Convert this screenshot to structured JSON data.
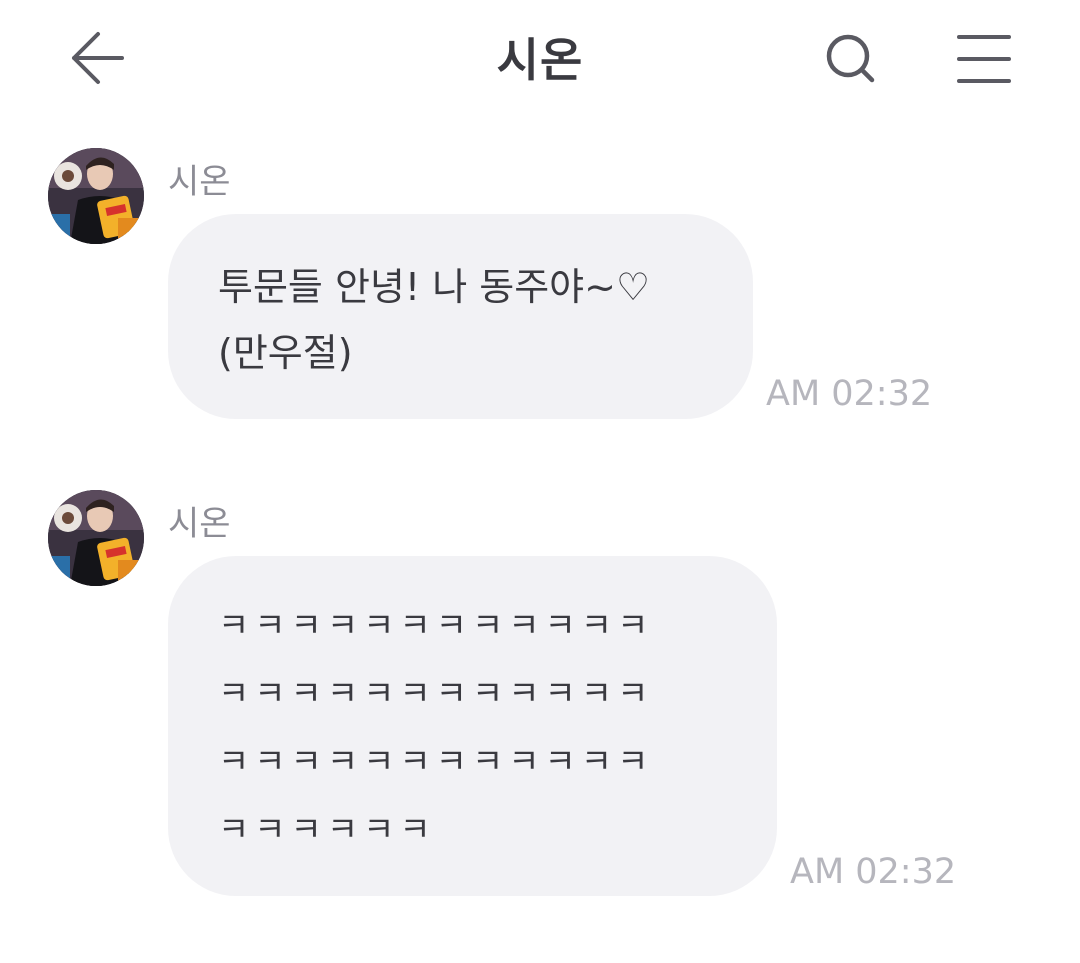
{
  "header": {
    "title": "시온",
    "back_icon": "arrow-left-icon",
    "search_icon": "search-icon",
    "menu_icon": "hamburger-menu-icon"
  },
  "messages": [
    {
      "sender": "시온",
      "text": "투문들 안녕! 나 동주야~♡\n(만우절)",
      "time": "AM 02:32"
    },
    {
      "sender": "시온",
      "text": "ㅋㅋㅋㅋㅋㅋㅋㅋㅋㅋㅋㅋ\nㅋㅋㅋㅋㅋㅋㅋㅋㅋㅋㅋㅋ\nㅋㅋㅋㅋㅋㅋㅋㅋㅋㅋㅋㅋ\nㅋㅋㅋㅋㅋㅋ",
      "time": "AM 02:32"
    }
  ],
  "colors": {
    "title": "#3a3a40",
    "bubble": "#f2f2f5",
    "sender": "#8c8c95",
    "time": "#b6b6bd",
    "icon": "#5a5a62"
  }
}
